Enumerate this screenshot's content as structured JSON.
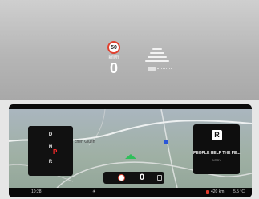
{
  "hud": {
    "speed_limit": "50",
    "unit": "km/h",
    "speed": "0",
    "icons": [
      "speed-limit-sign",
      "lane-assist-lines",
      "car-ahead"
    ]
  },
  "cockpit": {
    "map": {
      "street_label": "chen Glüen"
    },
    "gear": {
      "positions": [
        "D",
        "N",
        "R"
      ],
      "selected": "P"
    },
    "media": {
      "title": "PEOPLE HELP THE PE...",
      "artist": "BIRDY"
    },
    "center": {
      "speed_limit": "50",
      "speed": "0"
    },
    "status": {
      "time": "10:28",
      "range": "420 km",
      "temperature": "5.5 °C"
    }
  },
  "colors": {
    "accent_red": "#e23a2a",
    "speed_sign_border": "#e0412f"
  }
}
